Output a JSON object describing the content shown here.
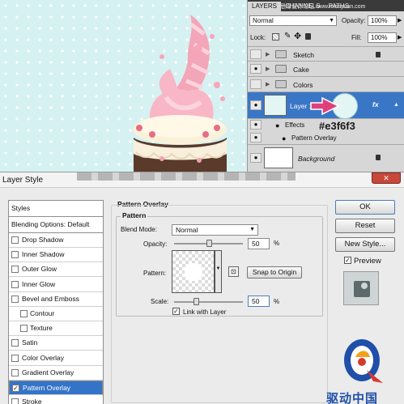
{
  "watermark_top": "思缘设计论坛 www.missyuan.com",
  "layers_panel": {
    "tabs": [
      "LAYERS",
      "CHANNELS",
      "PATHS"
    ],
    "blend_mode": "Normal",
    "opacity_label": "Opacity:",
    "opacity_value": "100%",
    "lock_label": "Lock:",
    "fill_label": "Fill:",
    "fill_value": "100%",
    "layers": [
      {
        "name": "Sketch",
        "type": "folder",
        "visible": false,
        "locked": true
      },
      {
        "name": "Cake",
        "type": "folder",
        "visible": true,
        "locked": false
      },
      {
        "name": "Colors",
        "type": "folder",
        "visible": false,
        "locked": false
      },
      {
        "name": "Layer 1",
        "type": "layer",
        "visible": true,
        "selected": true,
        "fx": "fx"
      },
      {
        "name": "Background",
        "type": "layer",
        "visible": true,
        "locked": true
      }
    ],
    "effects_label": "Effects",
    "effect_item": "Pattern Overlay",
    "color_annotation": "#e3f6f3"
  },
  "dialog": {
    "title": "Layer Style",
    "styles_header": "Styles",
    "blending_options": "Blending Options: Default",
    "style_items": [
      {
        "label": "Drop Shadow",
        "checked": false,
        "indent": false
      },
      {
        "label": "Inner Shadow",
        "checked": false,
        "indent": false
      },
      {
        "label": "Outer Glow",
        "checked": false,
        "indent": false
      },
      {
        "label": "Inner Glow",
        "checked": false,
        "indent": false
      },
      {
        "label": "Bevel and Emboss",
        "checked": false,
        "indent": false
      },
      {
        "label": "Contour",
        "checked": false,
        "indent": true
      },
      {
        "label": "Texture",
        "checked": false,
        "indent": true
      },
      {
        "label": "Satin",
        "checked": false,
        "indent": false
      },
      {
        "label": "Color Overlay",
        "checked": false,
        "indent": false
      },
      {
        "label": "Gradient Overlay",
        "checked": false,
        "indent": false
      },
      {
        "label": "Pattern Overlay",
        "checked": true,
        "indent": false,
        "selected": true
      },
      {
        "label": "Stroke",
        "checked": false,
        "indent": false
      }
    ],
    "section_title": "Pattern Overlay",
    "group_title": "Pattern",
    "blend_mode_label": "Blend Mode:",
    "blend_mode_value": "Normal",
    "opacity_label": "Opacity:",
    "opacity_value": "50",
    "opacity_unit": "%",
    "opacity_fraction": 0.5,
    "pattern_label": "Pattern:",
    "snap_button": "Snap to Origin",
    "scale_label": "Scale:",
    "scale_value": "50",
    "scale_unit": "%",
    "scale_fraction": 0.05,
    "link_label": "Link with Layer",
    "link_checked": true,
    "buttons": {
      "ok": "OK",
      "reset": "Reset",
      "new_style": "New Style...",
      "preview": "Preview"
    },
    "preview_checked": true
  },
  "logo_text": "驱动中国",
  "colors": {
    "canvas_bg": "#d6f1f2",
    "selected_layer": "#3a76c6",
    "selected_style": "#3474c8",
    "annotation_arrow": "#e0407a",
    "annotation_text": "#1a1a1a"
  }
}
